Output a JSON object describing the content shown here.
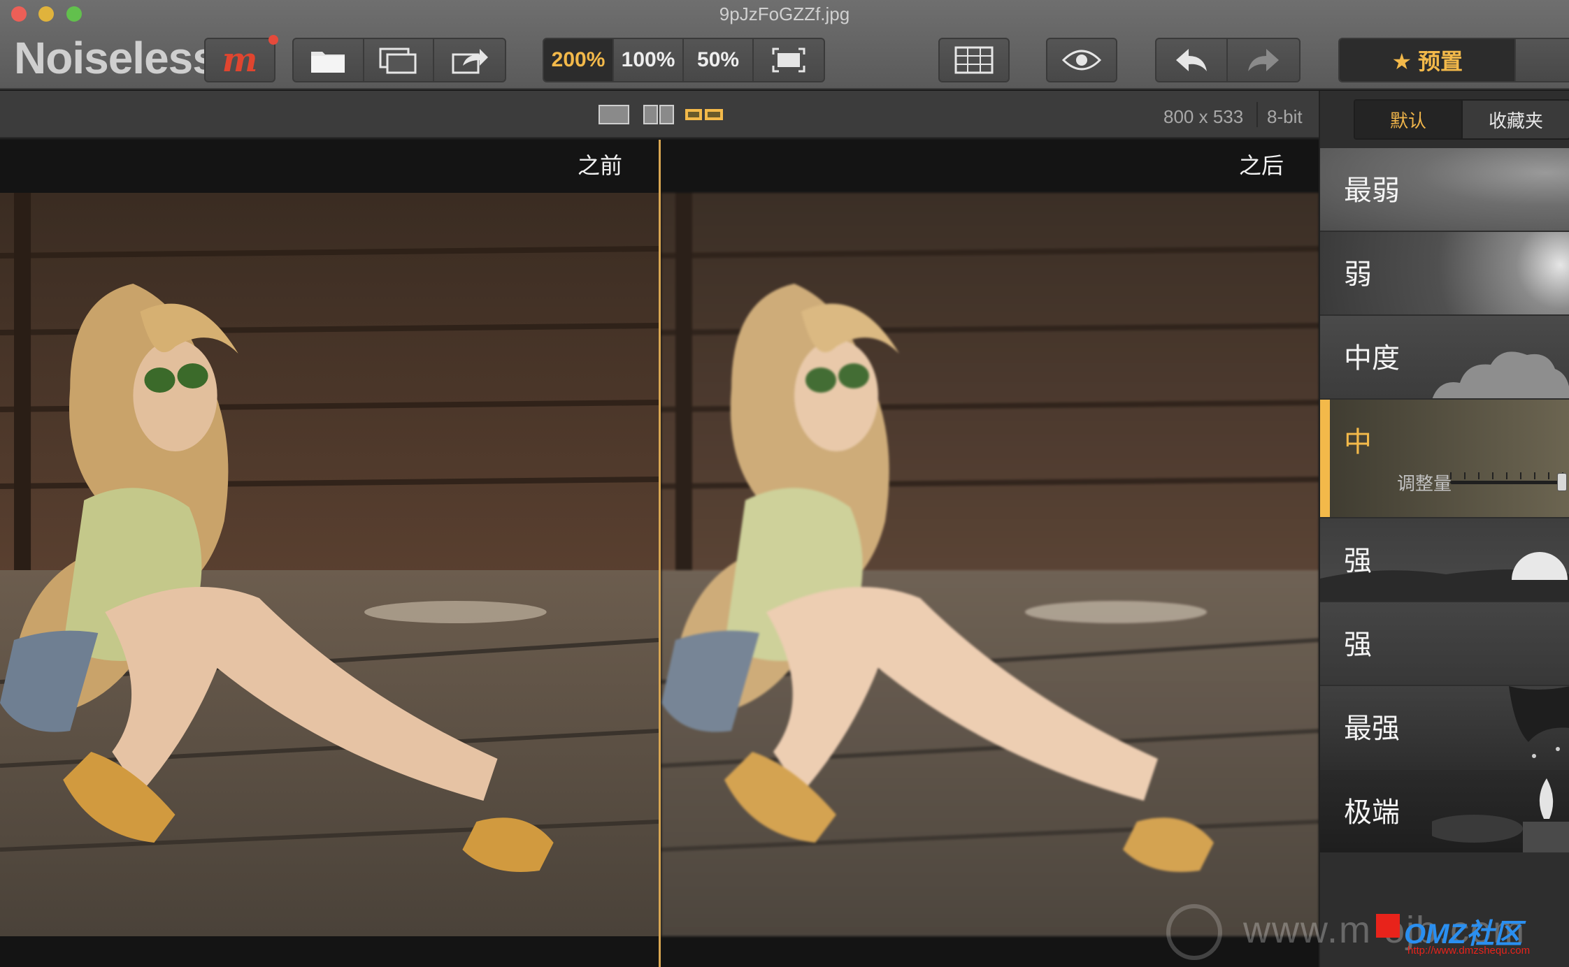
{
  "window": {
    "title": "9pJzFoGZZf.jpg"
  },
  "app": {
    "name": "Noiseless"
  },
  "toolbar": {
    "m_label": "m",
    "zoom_options": [
      "200%",
      "100%",
      "50%"
    ],
    "active_zoom": "200%",
    "presets_label": "★ 预置"
  },
  "image_info": {
    "size": "800 x 533",
    "depth": "8-bit"
  },
  "compare": {
    "before_label": "之前",
    "after_label": "之后"
  },
  "sidebar": {
    "tabs": [
      {
        "label": "默认",
        "active": true
      },
      {
        "label": "收藏夹",
        "active": false
      }
    ],
    "presets": [
      {
        "label": "最弱"
      },
      {
        "label": "弱"
      },
      {
        "label": "中度"
      },
      {
        "label": "中",
        "selected": true,
        "slider_label": "调整量",
        "amount": 1.0
      },
      {
        "label": "强"
      },
      {
        "label": "强"
      },
      {
        "label": "最强"
      },
      {
        "label": "极端"
      }
    ]
  },
  "watermark": {
    "text": "www.m ojb.com",
    "brand": "OMZ社区",
    "url": "http://www.dmzshequ.com"
  },
  "colors": {
    "accent": "#f3b94a",
    "logo_m": "#e0452f"
  }
}
